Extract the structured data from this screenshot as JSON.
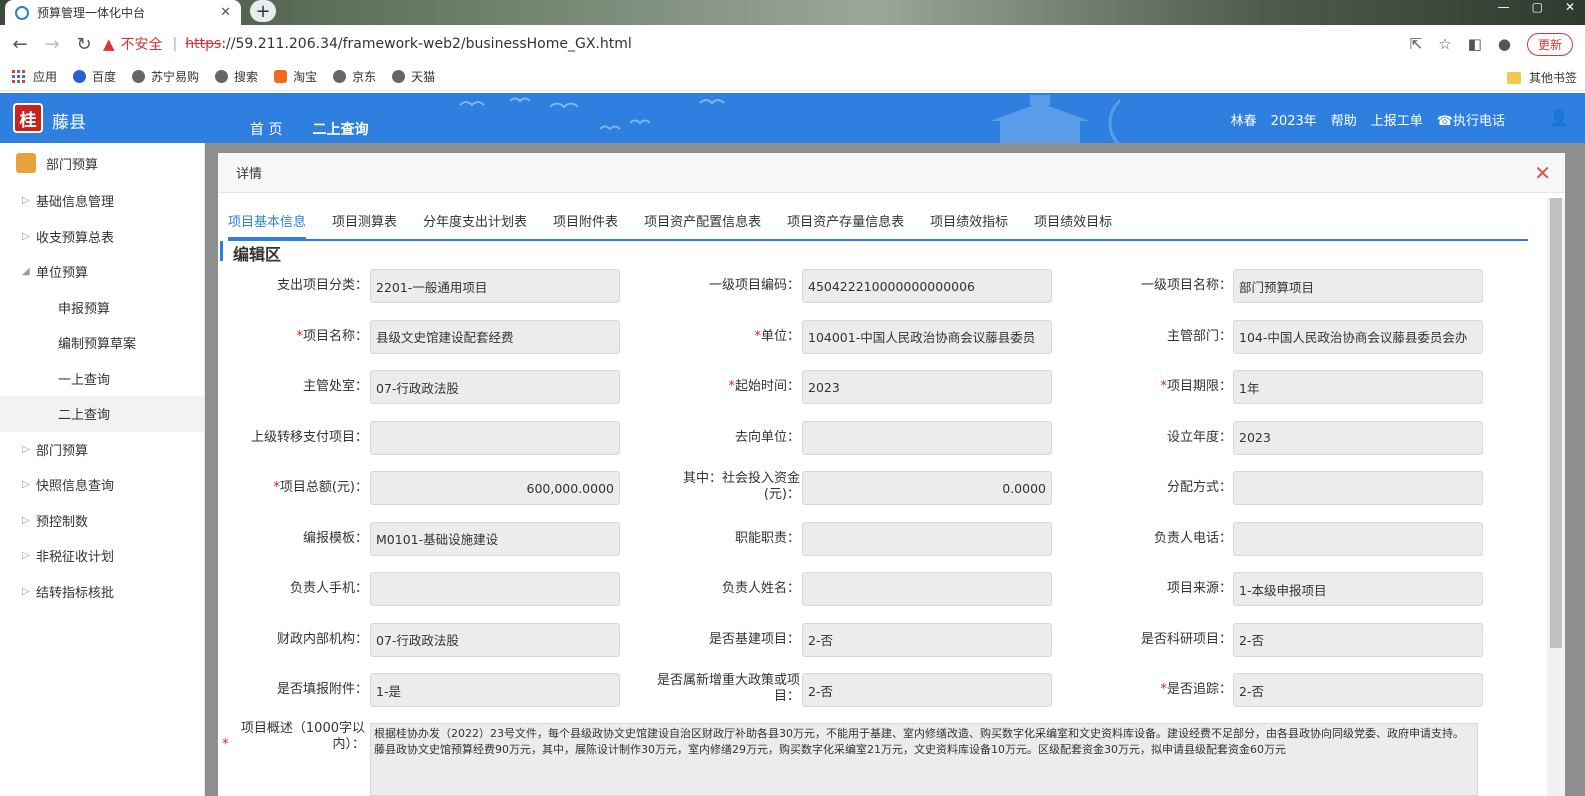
{
  "browser": {
    "tab_title": "预算管理一体化中台",
    "insecure_label": "不安全",
    "url_scheme": "https",
    "url_rest": "://59.211.206.34/framework-web2/businessHome_GX.html",
    "update_label": "更新",
    "bookmarks": [
      "应用",
      "百度",
      "苏宁易购",
      "搜索",
      "淘宝",
      "京东",
      "天猫"
    ],
    "other_bookmarks": "其他书签"
  },
  "app": {
    "logo_char": "桂",
    "system_name": "藤县",
    "nav": [
      "首 页",
      "二上查询"
    ],
    "user": "林春",
    "year": "2023年",
    "help": "帮助",
    "report": "上报工单",
    "phone": "☎执行电话"
  },
  "sidebar": {
    "top": "部门预算",
    "items": [
      {
        "label": "基础信息管理",
        "level": 1,
        "caret": "▷"
      },
      {
        "label": "收支预算总表",
        "level": 1,
        "caret": "▷"
      },
      {
        "label": "单位预算",
        "level": 1,
        "caret": "◢"
      },
      {
        "label": "申报预算",
        "level": 2,
        "caret": ""
      },
      {
        "label": "编制预算草案",
        "level": 2,
        "caret": ""
      },
      {
        "label": "一上查询",
        "level": 2,
        "caret": ""
      },
      {
        "label": "二上查询",
        "level": 2,
        "caret": ""
      },
      {
        "label": "部门预算",
        "level": 1,
        "caret": "▷"
      },
      {
        "label": "快照信息查询",
        "level": 1,
        "caret": "▷"
      },
      {
        "label": "预控制数",
        "level": 1,
        "caret": "▷"
      },
      {
        "label": "非税征收计划",
        "level": 1,
        "caret": "▷"
      },
      {
        "label": "结转指标核批",
        "level": 1,
        "caret": "▷"
      }
    ]
  },
  "dialog": {
    "title": "详情",
    "tabs": [
      "项目基本信息",
      "项目测算表",
      "分年度支出计划表",
      "项目附件表",
      "项目资产配置信息表",
      "项目资产存量信息表",
      "项目绩效指标",
      "项目绩效目标"
    ],
    "section": "编辑区",
    "rows": [
      [
        {
          "label": "支出项目分类：",
          "req": false,
          "value": "2201-一般通用项目"
        },
        {
          "label": "一级项目编码：",
          "req": false,
          "value": "450422210000000000006"
        },
        {
          "label": "一级项目名称：",
          "req": false,
          "value": "部门预算项目"
        }
      ],
      [
        {
          "label": "项目名称：",
          "req": true,
          "value": "县级文史馆建设配套经费"
        },
        {
          "label": "单位：",
          "req": true,
          "value": "104001-中国人民政治协商会议藤县委员"
        },
        {
          "label": "主管部门：",
          "req": false,
          "value": "104-中国人民政治协商会议藤县委员会办"
        }
      ],
      [
        {
          "label": "主管处室：",
          "req": false,
          "value": "07-行政政法股"
        },
        {
          "label": "起始时间：",
          "req": true,
          "value": "2023"
        },
        {
          "label": "项目期限：",
          "req": true,
          "value": "1年"
        }
      ],
      [
        {
          "label": "上级转移支付项目：",
          "req": false,
          "value": ""
        },
        {
          "label": "去向单位：",
          "req": false,
          "value": ""
        },
        {
          "label": "设立年度：",
          "req": false,
          "value": "2023"
        }
      ],
      [
        {
          "label": "项目总额(元)：",
          "req": true,
          "value": "600,000.0000",
          "num": true
        },
        {
          "label": "其中：社会投入资金(元)：",
          "req": false,
          "value": "0.0000",
          "num": true
        },
        {
          "label": "分配方式：",
          "req": false,
          "value": ""
        }
      ],
      [
        {
          "label": "编报模板：",
          "req": false,
          "value": "M0101-基础设施建设"
        },
        {
          "label": "职能职责：",
          "req": false,
          "value": ""
        },
        {
          "label": "负责人电话：",
          "req": false,
          "value": ""
        }
      ],
      [
        {
          "label": "负责人手机：",
          "req": false,
          "value": ""
        },
        {
          "label": "负责人姓名：",
          "req": false,
          "value": ""
        },
        {
          "label": "项目来源：",
          "req": false,
          "value": "1-本级申报项目"
        }
      ],
      [
        {
          "label": "财政内部机构：",
          "req": false,
          "value": "07-行政政法股"
        },
        {
          "label": "是否基建项目：",
          "req": false,
          "value": "2-否"
        },
        {
          "label": "是否科研项目：",
          "req": false,
          "value": "2-否"
        }
      ],
      [
        {
          "label": "是否填报附件：",
          "req": false,
          "value": "1-是"
        },
        {
          "label": "是否属新增重大政策或项目：",
          "req": false,
          "value": "2-否"
        },
        {
          "label": "是否追踪：",
          "req": true,
          "value": "2-否"
        }
      ]
    ],
    "desc_label": "项目概述（1000字以内）：",
    "desc_text": "根据桂协办发（2022）23号文件，每个县级政协文史馆建设自治区财政厅补助各县30万元，不能用于基建、室内修缮改造、购买数字化采编室和文史资料库设备。建设经费不足部分，由各县政协向同级党委、政府申请支持。藤县政协文史馆预算经费90万元，其中，展陈设计制作30万元，室内修缮29万元，购买数字化采编室21万元，文史资料库设备10万元。区级配套资金30万元，拟申请县级配套资金60万元"
  }
}
